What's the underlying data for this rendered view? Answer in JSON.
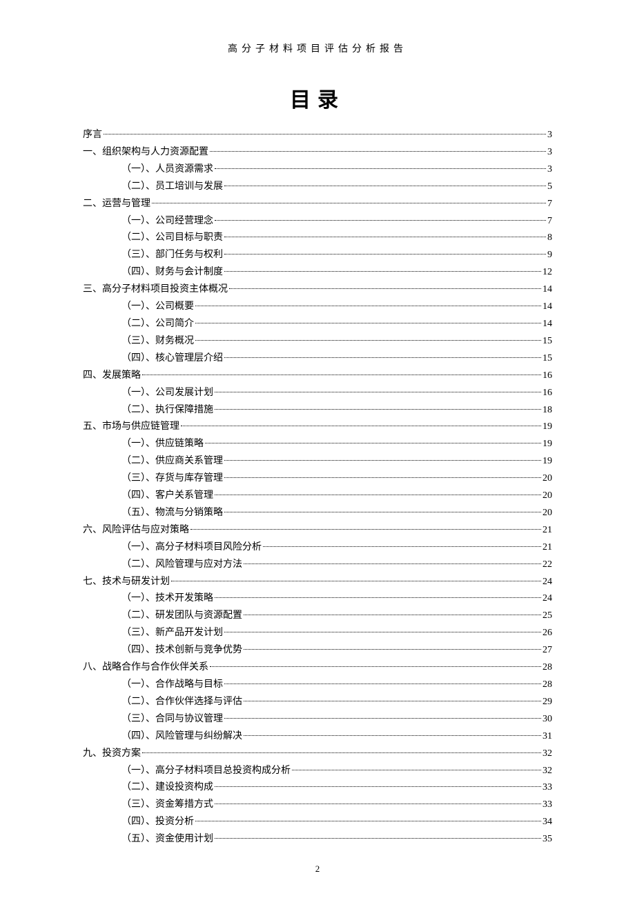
{
  "header": "高分子材料项目评估分析报告",
  "title": "目录",
  "page_number": "2",
  "toc": [
    {
      "level": 0,
      "label": "序言",
      "page": "3"
    },
    {
      "level": 0,
      "label": "一、组织架构与人力资源配置",
      "page": "3"
    },
    {
      "level": 1,
      "label": "（一）、人员资源需求",
      "page": "3"
    },
    {
      "level": 1,
      "label": "（二）、员工培训与发展",
      "page": "5"
    },
    {
      "level": 0,
      "label": "二、运营与管理",
      "page": "7"
    },
    {
      "level": 1,
      "label": "（一）、公司经营理念",
      "page": "7"
    },
    {
      "level": 1,
      "label": "（二）、公司目标与职责",
      "page": "8"
    },
    {
      "level": 1,
      "label": "（三）、部门任务与权利",
      "page": "9"
    },
    {
      "level": 1,
      "label": "（四）、财务与会计制度",
      "page": "12"
    },
    {
      "level": 0,
      "label": "三、高分子材料项目投资主体概况",
      "page": "14"
    },
    {
      "level": 1,
      "label": "（一）、公司概要",
      "page": "14"
    },
    {
      "level": 1,
      "label": "（二）、公司简介",
      "page": "14"
    },
    {
      "level": 1,
      "label": "（三）、财务概况",
      "page": "15"
    },
    {
      "level": 1,
      "label": "（四）、核心管理层介绍",
      "page": "15"
    },
    {
      "level": 0,
      "label": "四、发展策略",
      "page": "16"
    },
    {
      "level": 1,
      "label": "（一）、公司发展计划",
      "page": "16"
    },
    {
      "level": 1,
      "label": "（二）、执行保障措施",
      "page": "18"
    },
    {
      "level": 0,
      "label": "五、市场与供应链管理",
      "page": "19"
    },
    {
      "level": 1,
      "label": "（一）、供应链策略",
      "page": "19"
    },
    {
      "level": 1,
      "label": "（二）、供应商关系管理",
      "page": "19"
    },
    {
      "level": 1,
      "label": "（三）、存货与库存管理",
      "page": "20"
    },
    {
      "level": 1,
      "label": "（四）、客户关系管理",
      "page": "20"
    },
    {
      "level": 1,
      "label": "（五）、物流与分销策略",
      "page": "20"
    },
    {
      "level": 0,
      "label": "六、风险评估与应对策略",
      "page": "21"
    },
    {
      "level": 1,
      "label": "（一）、高分子材料项目风险分析",
      "page": "21"
    },
    {
      "level": 1,
      "label": "（二）、风险管理与应对方法",
      "page": "22"
    },
    {
      "level": 0,
      "label": "七、技术与研发计划",
      "page": "24"
    },
    {
      "level": 1,
      "label": "（一）、技术开发策略",
      "page": "24"
    },
    {
      "level": 1,
      "label": "（二）、研发团队与资源配置",
      "page": "25"
    },
    {
      "level": 1,
      "label": "（三）、新产品开发计划",
      "page": "26"
    },
    {
      "level": 1,
      "label": "（四）、技术创新与竞争优势",
      "page": "27"
    },
    {
      "level": 0,
      "label": "八、战略合作与合作伙伴关系",
      "page": "28"
    },
    {
      "level": 1,
      "label": "（一）、合作战略与目标",
      "page": "28"
    },
    {
      "level": 1,
      "label": "（二）、合作伙伴选择与评估",
      "page": "29"
    },
    {
      "level": 1,
      "label": "（三）、合同与协议管理",
      "page": "30"
    },
    {
      "level": 1,
      "label": "（四）、风险管理与纠纷解决",
      "page": "31"
    },
    {
      "level": 0,
      "label": "九、投资方案",
      "page": "32"
    },
    {
      "level": 1,
      "label": "（一）、高分子材料项目总投资构成分析",
      "page": "32"
    },
    {
      "level": 1,
      "label": "（二）、建设投资构成",
      "page": "33"
    },
    {
      "level": 1,
      "label": "（三）、资金筹措方式",
      "page": "33"
    },
    {
      "level": 1,
      "label": "（四）、投资分析",
      "page": "34"
    },
    {
      "level": 1,
      "label": "（五）、资金使用计划",
      "page": "35"
    }
  ]
}
